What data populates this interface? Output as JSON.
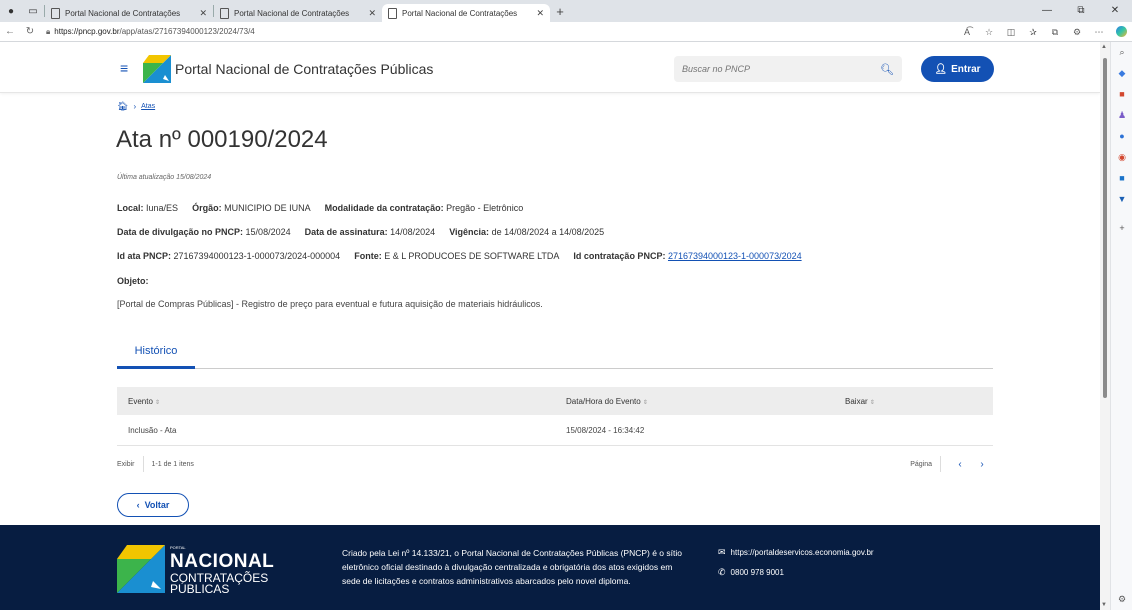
{
  "browser": {
    "tabs": [
      {
        "title": "Portal Nacional de Contratações"
      },
      {
        "title": "Portal Nacional de Contratações"
      },
      {
        "title": "Portal Nacional de Contratações"
      }
    ],
    "url_host": "https://pncp.gov.br",
    "url_path": "/app/atas/27167394000123/2024/73/4"
  },
  "header": {
    "site_name": "Portal Nacional de Contratações Públicas",
    "search_placeholder": "Buscar no PNCP",
    "login_label": "Entrar"
  },
  "breadcrumb": {
    "link": "Atas"
  },
  "page": {
    "title": "Ata nº 000190/2024",
    "updated": "Última atualização 15/08/2024"
  },
  "info": {
    "local_label": "Local:",
    "local_value": "Iuna/ES",
    "orgao_label": "Órgão:",
    "orgao_value": "MUNICIPIO DE IUNA",
    "modalidade_label": "Modalidade da contratação:",
    "modalidade_value": "Pregão - Eletrônico",
    "divulgacao_label": "Data de divulgação no PNCP:",
    "divulgacao_value": "15/08/2024",
    "assinatura_label": "Data de assinatura:",
    "assinatura_value": "14/08/2024",
    "vigencia_label": "Vigência:",
    "vigencia_value": "de 14/08/2024 a 14/08/2025",
    "idata_label": "Id ata PNCP:",
    "idata_value": "27167394000123-1-000073/2024-000004",
    "fonte_label": "Fonte:",
    "fonte_value": "E & L PRODUCOES DE SOFTWARE LTDA",
    "idcontratacao_label": "Id contratação PNCP:",
    "idcontratacao_value": "27167394000123-1-000073/2024",
    "objeto_label": "Objeto:",
    "objeto_text": "[Portal de Compras Públicas] - Registro de preço para eventual e futura aquisição de materiais hidráulicos."
  },
  "tabs": {
    "historico": "Histórico"
  },
  "table": {
    "headers": [
      "Evento",
      "Data/Hora do Evento",
      "Baixar"
    ],
    "rows": [
      {
        "evento": "Inclusão - Ata",
        "data": "15/08/2024 - 16:34:42",
        "baixar": ""
      }
    ]
  },
  "pager": {
    "exibir": "Exibir",
    "range": "1-1 de 1 itens",
    "pagina": "Página"
  },
  "back_label": "Voltar",
  "footer": {
    "portal": "PORTAL",
    "nacional": "NACIONAL",
    "contratacoes": "CONTRATAÇÕES",
    "publicas": "PÚBLICAS",
    "description": "Criado pela Lei nº 14.133/21, o Portal Nacional de Contratações Públicas (PNCP) é o sítio eletrônico oficial destinado à divulgação centralizada e obrigatória dos atos exigidos em sede de licitações e contratos administrativos abarcados pelo novel diploma.",
    "website": "https://portaldeservicos.economia.gov.br",
    "phone": "0800 978 9001"
  },
  "colors": {
    "primary": "#1351b4",
    "footer_bg": "#071d41"
  }
}
